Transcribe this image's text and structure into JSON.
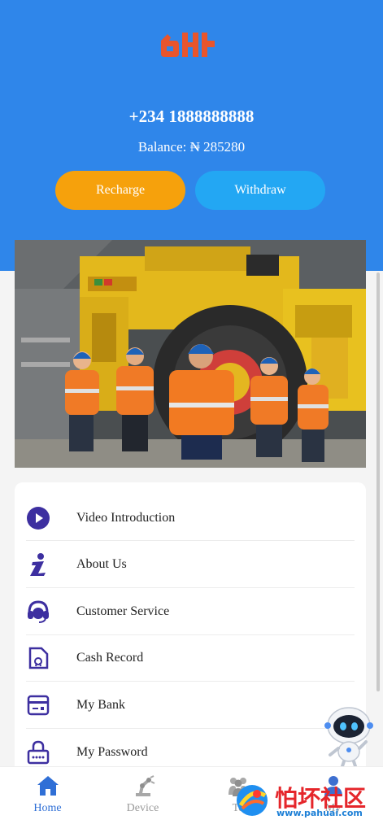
{
  "header": {
    "phone": "+234 1888888888",
    "balance": "Balance: ₦ 285280",
    "recharge_label": "Recharge",
    "withdraw_label": "Withdraw",
    "brand_color": "#2f86ea"
  },
  "menu": {
    "items": [
      {
        "label": "Video Introduction",
        "icon": "play-icon"
      },
      {
        "label": "About Us",
        "icon": "info-icon"
      },
      {
        "label": "Customer Service",
        "icon": "headset-icon"
      },
      {
        "label": "Cash Record",
        "icon": "document-icon"
      },
      {
        "label": "My Bank",
        "icon": "bank-card-icon"
      },
      {
        "label": "My Password",
        "icon": "lock-icon"
      }
    ]
  },
  "tabs": [
    {
      "label": "Home",
      "icon": "home-icon",
      "active": true
    },
    {
      "label": "Device",
      "icon": "robot-arm-icon",
      "active": false
    },
    {
      "label": "Te",
      "icon": "team-icon",
      "active": false
    },
    {
      "label": "My",
      "icon": "user-icon",
      "active": false
    }
  ],
  "watermark": {
    "title": "怕坏社区",
    "url": "www.pahuai.com"
  }
}
